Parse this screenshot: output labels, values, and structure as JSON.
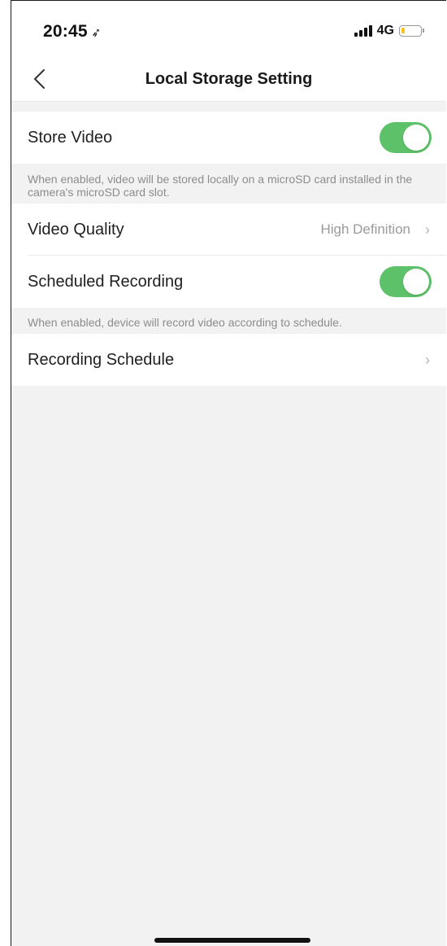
{
  "status_bar": {
    "time": "20:45",
    "location_glyph": "➶",
    "network": "4G",
    "battery_level": 0.2,
    "battery_color": "#f5c518"
  },
  "nav": {
    "title": "Local Storage Setting",
    "back_icon": "chevron-left-icon"
  },
  "settings": {
    "store_video": {
      "label": "Store Video",
      "enabled": true,
      "note": "When enabled, video will be stored locally on a microSD card installed in the camera's microSD card slot."
    },
    "video_quality": {
      "label": "Video Quality",
      "value": "High Definition"
    },
    "scheduled_recording": {
      "label": "Scheduled Recording",
      "enabled": true,
      "note": "When enabled, device will record video according to schedule."
    },
    "recording_schedule": {
      "label": "Recording Schedule"
    }
  },
  "colors": {
    "toggle_on": "#5cc168",
    "background": "#f2f2f2"
  }
}
